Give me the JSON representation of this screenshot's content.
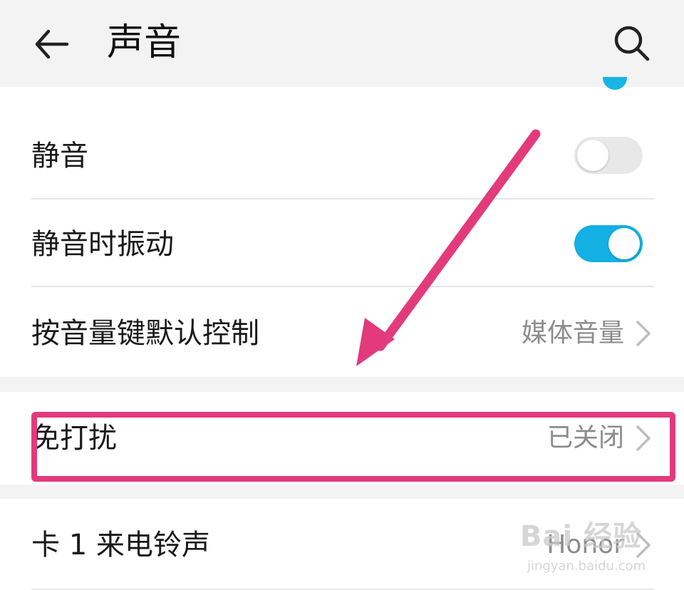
{
  "header": {
    "title": "声音"
  },
  "settings": {
    "mute_label": "静音",
    "mute_on": false,
    "vibrate_label": "静音时振动",
    "vibrate_on": true,
    "volume_key_label": "按音量键默认控制",
    "volume_key_value": "媒体音量",
    "dnd_label": "免打扰",
    "dnd_value": "已关闭",
    "ringtone_label": "卡 1 来电铃声",
    "ringtone_value": "Honor"
  },
  "colors": {
    "accent": "#12b0e3",
    "annotation": "#e33a7c"
  },
  "icons": {
    "back": "arrow-left",
    "search": "magnifier",
    "chevron": "chevron-right"
  },
  "watermark": {
    "brand": "Bai 经验",
    "url": "jingyan.baidu.com"
  }
}
